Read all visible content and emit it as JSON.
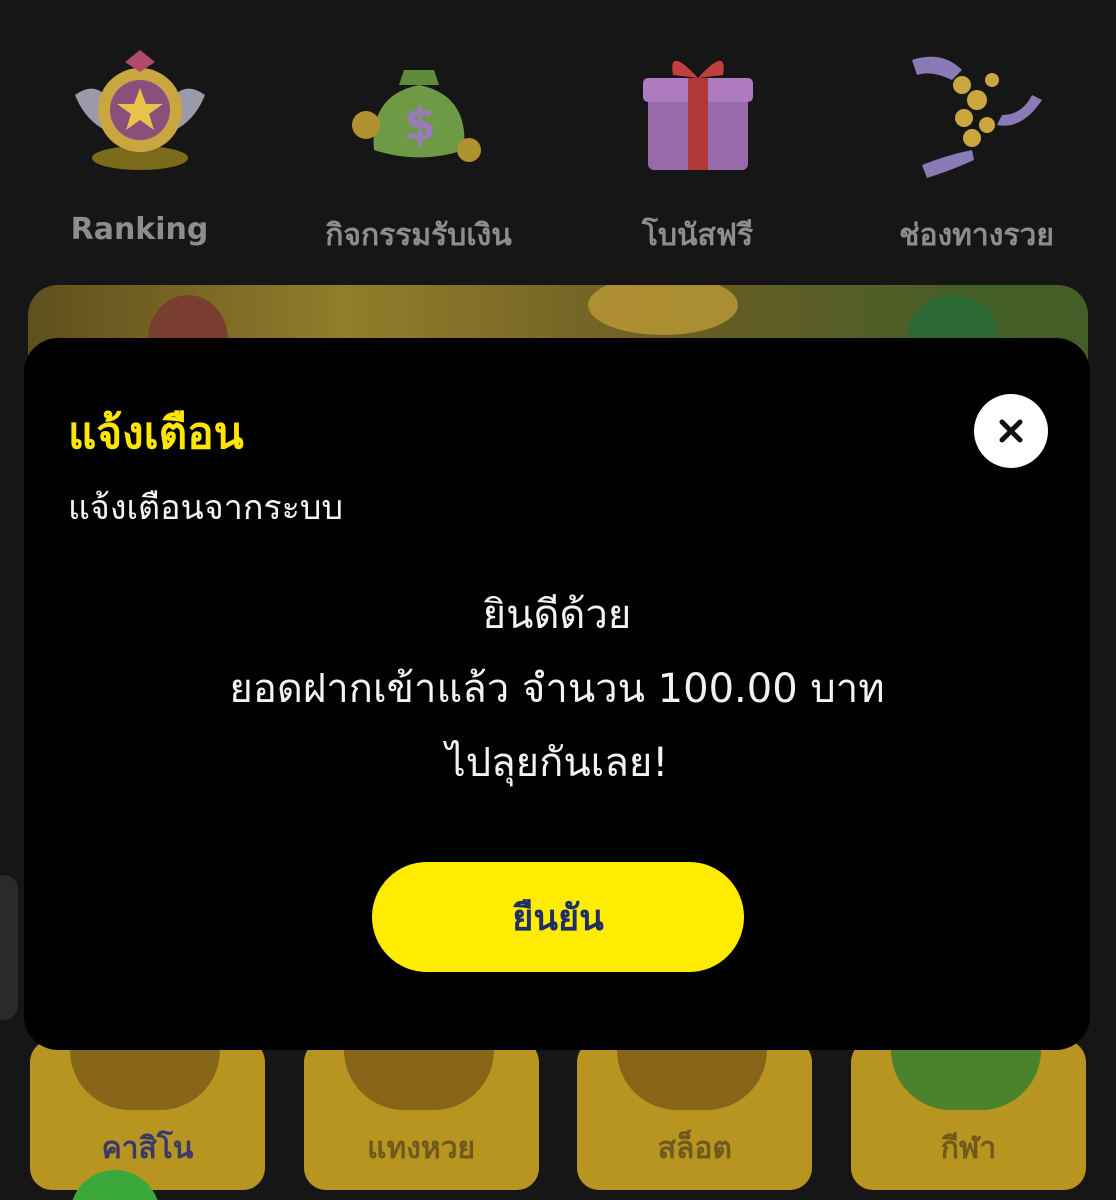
{
  "quick_menu": [
    {
      "label": "Ranking",
      "icon": "ranking-badge-icon"
    },
    {
      "label": "กิจกรรมรับเงิน",
      "icon": "money-bag-icon"
    },
    {
      "label": "โบนัสฟรี",
      "icon": "gift-box-icon"
    },
    {
      "label": "ช่องทางรวย",
      "icon": "coins-hands-icon"
    }
  ],
  "games": [
    {
      "label": "คาสิโน"
    },
    {
      "label": "แทงหวย"
    },
    {
      "label": "สล็อต"
    },
    {
      "label": "กีฬา"
    }
  ],
  "modal": {
    "title": "แจ้งเตือน",
    "subtitle": "แจ้งเตือนจากระบบ",
    "message_lines": [
      "ยินดีด้วย",
      "ยอดฝากเข้าแล้ว จำนวน 100.00 บาท",
      "ไปลุยกันเลย!"
    ],
    "confirm_label": "ยืนยัน",
    "close_icon": "close-icon"
  },
  "colors": {
    "accent_yellow": "#ffe600",
    "button_text": "#1e2f66",
    "modal_bg": "#000000"
  }
}
